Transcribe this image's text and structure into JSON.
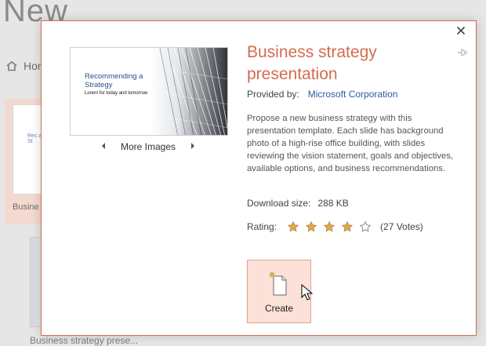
{
  "background": {
    "title": "New",
    "home_label": "Hom",
    "card_thumb_text": "Rec a St",
    "card_label": "Busine",
    "caption": "Business strategy prese..."
  },
  "dialog": {
    "title": "Business strategy presentation",
    "provided_label": "Provided by:",
    "provider": "Microsoft Corporation",
    "description": "Propose a new business strategy with this presentation template. Each slide has background photo of a high-rise office building, with slides reviewing the vision statement, goals and objectives, available options, and business recommendations.",
    "download_label": "Download size:",
    "download_size": "288 KB",
    "rating_label": "Rating:",
    "rating_value": 4,
    "rating_max": 5,
    "votes": "(27 Votes)",
    "more_images": "More Images",
    "create_label": "Create",
    "preview": {
      "title": "Recommending a Strategy",
      "subtitle": "Lorem for today and tomorrow"
    }
  },
  "colors": {
    "accent": "#d46b4f",
    "link": "#2b5c9e",
    "create_bg": "#fbe1d7",
    "star_fill": "#d8aa4f"
  },
  "icons": {
    "close": "close-icon",
    "pin": "pin-icon",
    "prev": "chevron-left-icon",
    "next": "chevron-right-icon",
    "create": "new-document-icon",
    "home": "home-icon",
    "cursor": "mouse-pointer-icon"
  }
}
